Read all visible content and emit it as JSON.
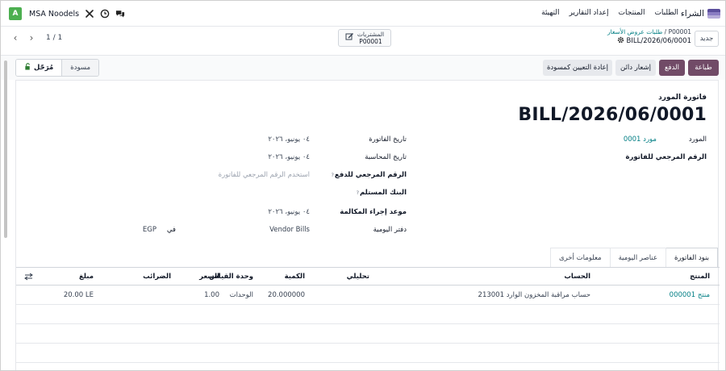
{
  "navbar": {
    "app_name": "الشراء",
    "menu": [
      "الطلبات",
      "المنتجات",
      "إعداد التقارير",
      "التهيئة"
    ],
    "company": "MSA Noodels",
    "avatar_letter": "A"
  },
  "control_panel": {
    "pager_value": "1 / 1",
    "chatter_label": "المشتريات",
    "chatter_ref": "P00001",
    "breadcrumb_parent": "طلبات عروض الأسعار",
    "breadcrumb_ref": "P00001",
    "breadcrumb_current": "BILL/2026/06/0001",
    "new_button": "جديد"
  },
  "actions": {
    "print": "طباعة",
    "pay": "الدفع",
    "credit_note": "إشعار دائن",
    "reset_draft": "إعادة التعيين كمسودة"
  },
  "status": {
    "posted": "مُرَحّل",
    "draft": "مسودة"
  },
  "bill": {
    "type_label": "فاتورة المورد",
    "name": "BILL/2026/06/0001",
    "vendor_label": "المورد",
    "vendor_value": "مورد 0001",
    "bill_reference_label": "الرقم المرجعي للفاتورة",
    "invoice_date_label": "تاريخ الفاتورة",
    "invoice_date_value": "٠٤ يونيو، ٢٠٢٦",
    "accounting_date_label": "تاريخ المحاسبة",
    "accounting_date_value": "٠٤ يونيو، ٢٠٢٦",
    "payment_reference_label": "الرقم المرجعي للدفع",
    "payment_reference_placeholder": "استخدم الرقم المرجعي للفاتورة",
    "recipient_bank_label": "البنك المستلم",
    "due_date_label": "موعد إجراء المكالمة",
    "due_date_value": "٠٤ يونيو، ٢٠٢٦",
    "journal_label": "دفتر اليومية",
    "journal_value": "Vendor Bills",
    "in_label": "في",
    "currency_value": "EGP"
  },
  "tabs": [
    "بنود الفاتورة",
    "عناصر اليومية",
    "معلومات أخرى"
  ],
  "lines": {
    "headers": {
      "product": "المنتج",
      "account": "الحساب",
      "analytic": "تحليلي",
      "quantity": "الكمية",
      "uom": "وحدة القياس",
      "price": "السعر",
      "taxes": "الضرائب",
      "amount": "مبلغ"
    },
    "rows": [
      {
        "product": "منتج 000001",
        "account": "213001 حساب مراقبة المخزون الوارد",
        "analytic": "",
        "quantity": "20.000000",
        "uom": "الوحدات",
        "price": "1.00",
        "taxes": "",
        "amount": "20.00 LE"
      }
    ]
  },
  "colors": {
    "primary": "#714b67",
    "link": "#017e84",
    "avatar": "#4caf50"
  }
}
